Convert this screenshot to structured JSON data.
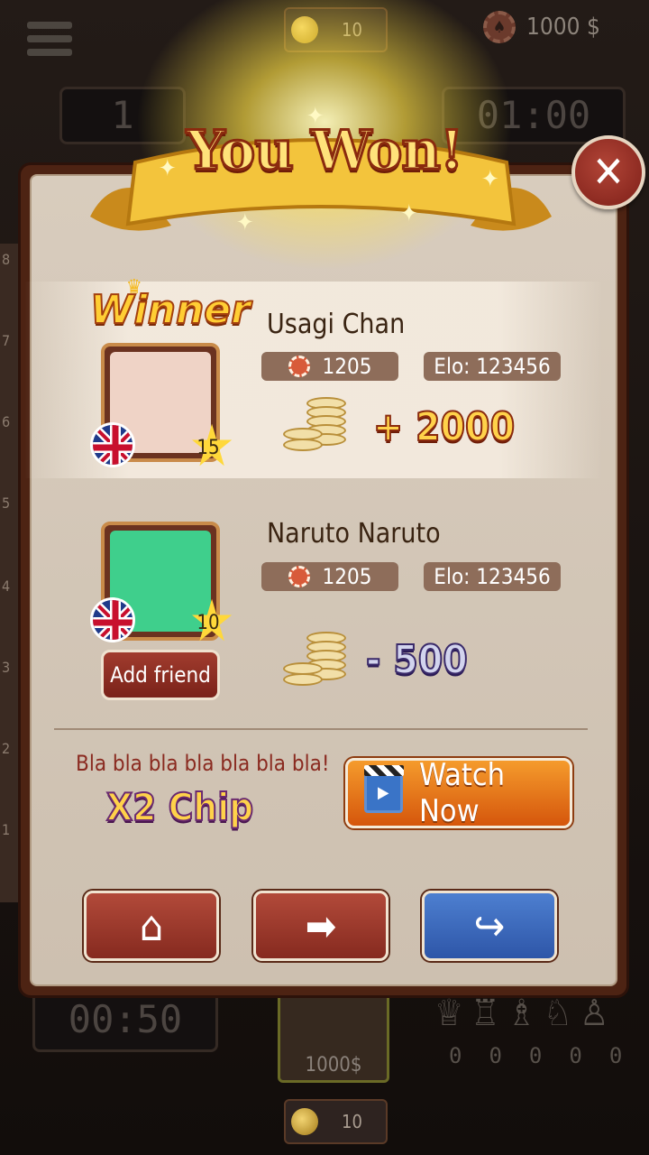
{
  "background": {
    "top_medal_value": "10",
    "chips_balance": "1000 $",
    "left_score": "1",
    "timer_top": "01:00",
    "timer_bottom": "00:50",
    "board_ranks": [
      "8",
      "7",
      "6",
      "5",
      "4",
      "3",
      "2",
      "1"
    ],
    "captured_counts": [
      "0",
      "0",
      "0",
      "0",
      "0"
    ],
    "captured_pieces": [
      "♕",
      "♖",
      "♗",
      "♘",
      "♙"
    ],
    "player_coins": "1000$",
    "bottom_medal_value": "10"
  },
  "dialog": {
    "title": "You Won!",
    "close_icon": "✕",
    "winner": {
      "label": "Winner",
      "name": "Usagi Chan",
      "chips": "1205",
      "elo": "Elo: 123456",
      "level": "15",
      "reward": "+ 2000",
      "flag": "uk-flag",
      "avatar_color": "#efd3c6"
    },
    "loser": {
      "name": "Naruto Naruto",
      "chips": "1205",
      "elo": "Elo: 123456",
      "level": "10",
      "reward": "- 500",
      "flag": "uk-flag",
      "avatar_color": "#3fcf8c",
      "add_friend_label": "Add friend"
    },
    "promo": {
      "text": "Bla bla bla bla bla bla bla!",
      "title": "X2 Chip",
      "watch_label": "Watch Now"
    },
    "actions": [
      {
        "name": "home-button",
        "icon": "⌂",
        "color": "red"
      },
      {
        "name": "next-button",
        "icon": "➡",
        "color": "red"
      },
      {
        "name": "share-button",
        "icon": "↪",
        "color": "blue"
      }
    ]
  }
}
